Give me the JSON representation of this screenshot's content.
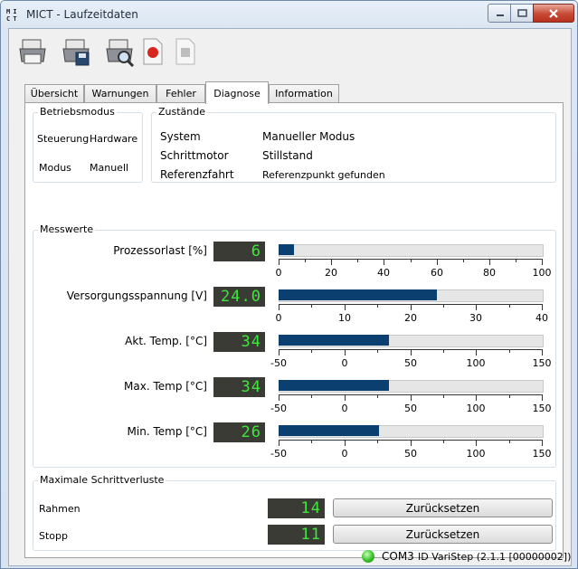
{
  "window": {
    "title": "MICT - Laufzeitdaten",
    "app_icon_text": "MICT"
  },
  "tabs": [
    {
      "label": "Übersicht"
    },
    {
      "label": "Warnungen"
    },
    {
      "label": "Fehler"
    },
    {
      "label": "Diagnose"
    },
    {
      "label": "Information"
    }
  ],
  "active_tab": "Diagnose",
  "betriebsmodus": {
    "title": "Betriebsmodus",
    "steuerung_label": "Steuerung",
    "steuerung_value": "Hardware",
    "modus_label": "Modus",
    "modus_value": "Manuell"
  },
  "zustaende": {
    "title": "Zustände",
    "rows": [
      {
        "label": "System",
        "value": "Manueller Modus"
      },
      {
        "label": "Schrittmotor",
        "value": "Stillstand"
      },
      {
        "label": "Referenzfahrt",
        "value": "Referenzpunkt gefunden"
      }
    ]
  },
  "messwerte": {
    "title": "Messwerte",
    "bar_color": "#0b3f6f",
    "gauges": [
      {
        "label": "Prozessorlast [%]",
        "display": "6",
        "value": 6,
        "min": 0,
        "max": 100,
        "ticks": [
          "0",
          "20",
          "40",
          "60",
          "80",
          "100"
        ]
      },
      {
        "label": "Versorgungsspannung [V]",
        "display": "24.0",
        "value": 24,
        "min": 0,
        "max": 40,
        "ticks": [
          "0",
          "10",
          "20",
          "30",
          "40"
        ]
      },
      {
        "label": "Akt. Temp. [°C]",
        "display": "34",
        "value": 34,
        "min": -50,
        "max": 150,
        "ticks": [
          "-50",
          "0",
          "50",
          "100",
          "150"
        ]
      },
      {
        "label": "Max. Temp [°C]",
        "display": "34",
        "value": 34,
        "min": -50,
        "max": 150,
        "ticks": [
          "-50",
          "0",
          "50",
          "100",
          "150"
        ]
      },
      {
        "label": "Min. Temp [°C]",
        "display": "26",
        "value": 26,
        "min": -50,
        "max": 150,
        "ticks": [
          "-50",
          "0",
          "50",
          "100",
          "150"
        ]
      }
    ]
  },
  "schrittverluste": {
    "title": "Maximale Schrittverluste",
    "rows": [
      {
        "label": "Rahmen",
        "display": "14",
        "button": "Zurücksetzen"
      },
      {
        "label": "Stopp",
        "display": "11",
        "button": "Zurücksetzen"
      }
    ]
  },
  "status": {
    "port": "COM3",
    "device": "ID VariStep (2.1.1 [00000002])",
    "led_color": "#3fc72f"
  }
}
